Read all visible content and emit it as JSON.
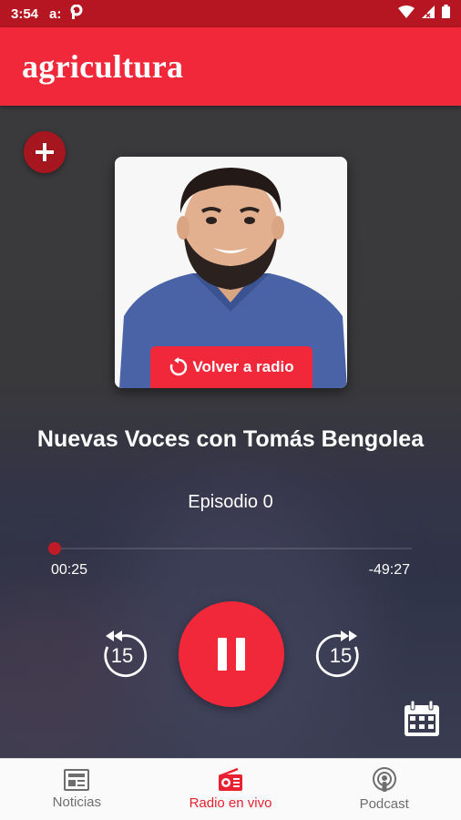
{
  "status_bar": {
    "time": "3:54",
    "notification_text": "a:",
    "notification_icons": [
      "a-icon",
      "p-icon"
    ],
    "system_icons": [
      "wifi-icon",
      "signal-icon",
      "battery-icon"
    ]
  },
  "app_bar": {
    "title": "agricultura"
  },
  "player": {
    "add_button_icon": "plus-icon",
    "back_to_radio_label": "Volver a radio",
    "episode_title": "Nuevas Voces con Tomás Bengolea",
    "episode_subtitle": "Episodio 0",
    "elapsed": "00:25",
    "remaining": "-49:27",
    "progress_fraction": 0.008,
    "skip_back_seconds": "15",
    "skip_forward_seconds": "15",
    "play_state": "playing",
    "calendar_icon": "calendar-icon"
  },
  "bottom_nav": {
    "items": [
      {
        "label": "Noticias",
        "icon": "newspaper-icon",
        "active": false
      },
      {
        "label": "Radio en vivo",
        "icon": "radio-icon",
        "active": true
      },
      {
        "label": "Podcast",
        "icon": "podcast-icon",
        "active": false
      }
    ]
  },
  "colors": {
    "accent": "#f0283a",
    "status_bar": "#b51622",
    "nav_inactive": "#6e6e6e",
    "nav_active": "#e8202f"
  }
}
